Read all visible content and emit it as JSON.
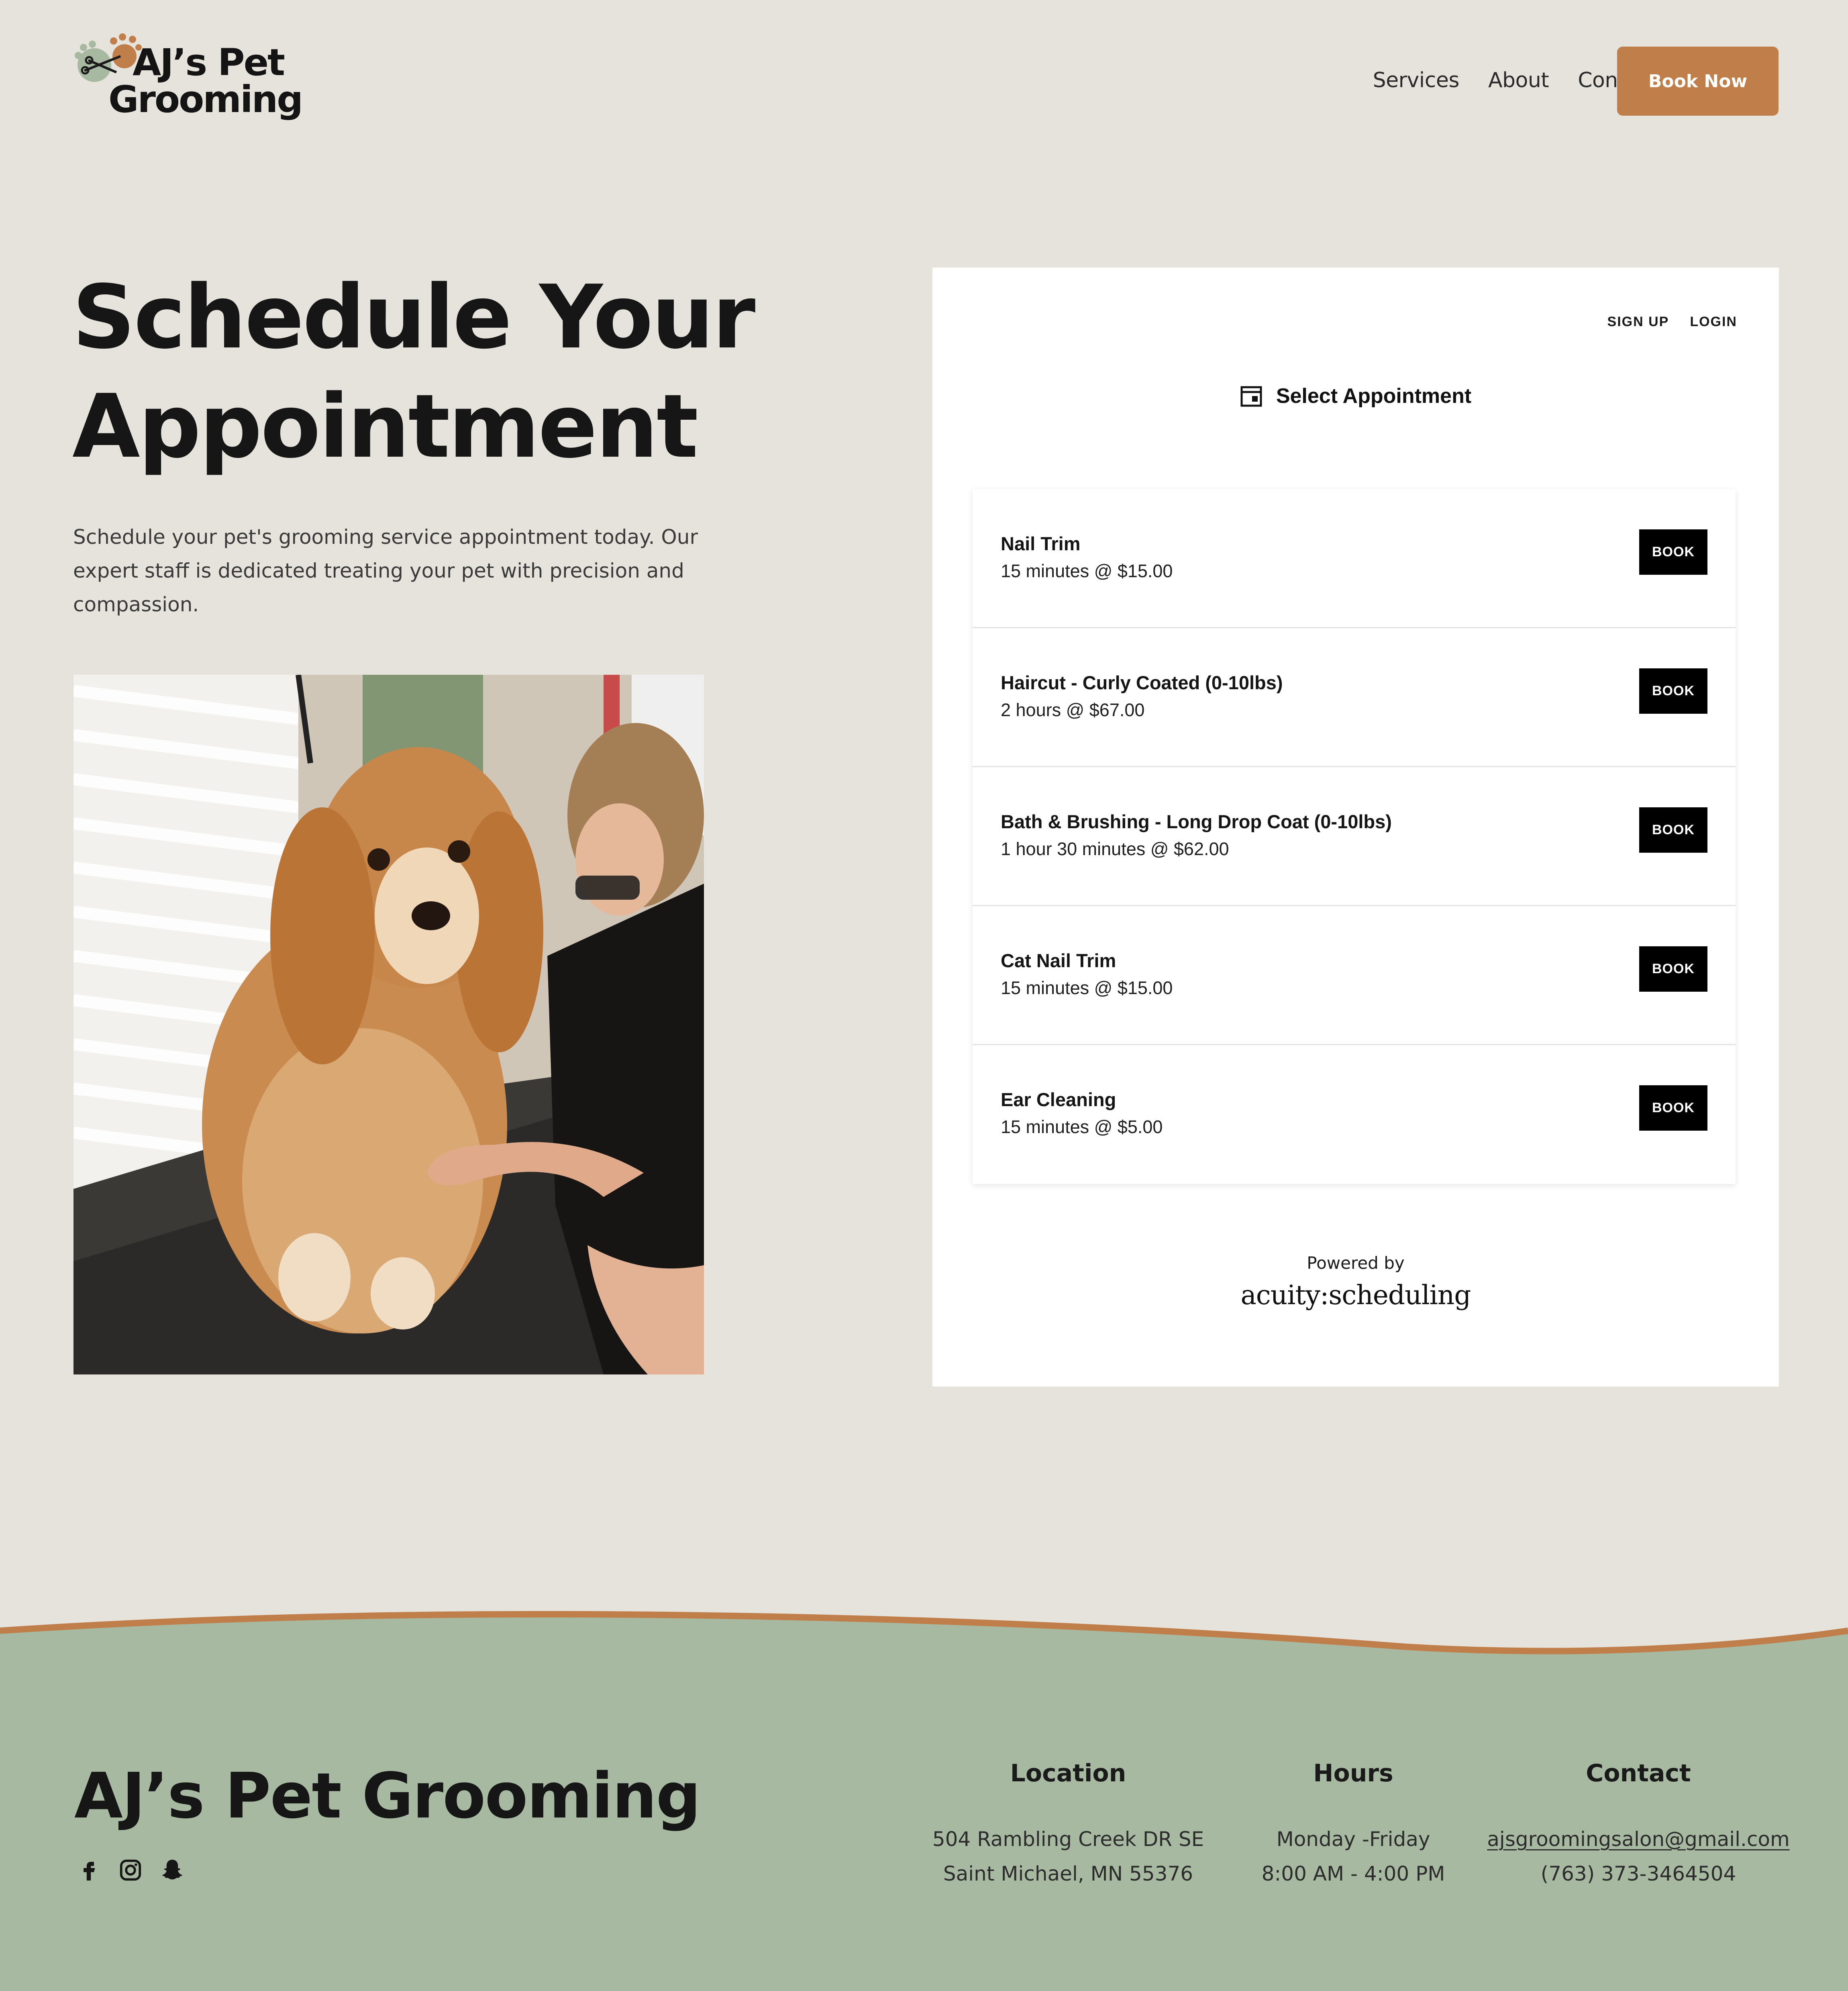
{
  "header": {
    "logo_line1": "AJ’s Pet",
    "logo_line2": "Grooming",
    "nav": [
      "Services",
      "About",
      "Contact"
    ],
    "cta": "Book Now"
  },
  "hero": {
    "title_line1": "Schedule Your",
    "title_line2": "Appointment",
    "description": "Schedule your pet's grooming service appointment today. Our expert staff is dedicated treating your pet with precision and compassion."
  },
  "scheduler": {
    "sign_up": "SIGN UP",
    "login": "LOGIN",
    "heading": "Select Appointment",
    "appointments": [
      {
        "name": "Nail Trim",
        "meta": "15 minutes @ $15.00",
        "button": "BOOK"
      },
      {
        "name": "Haircut - Curly Coated (0-10lbs)",
        "meta": "2 hours @ $67.00",
        "button": "BOOK"
      },
      {
        "name": "Bath & Brushing - Long Drop Coat (0-10lbs)",
        "meta": "1 hour 30 minutes @ $62.00",
        "button": "BOOK"
      },
      {
        "name": "Cat Nail Trim",
        "meta": "15 minutes @ $15.00",
        "button": "BOOK"
      },
      {
        "name": "Ear Cleaning",
        "meta": "15 minutes @ $5.00",
        "button": "BOOK"
      }
    ],
    "powered_by": "Powered by",
    "powered_brand": "acuity:scheduling"
  },
  "footer": {
    "brand": "AJ’s Pet Grooming",
    "socials": [
      "facebook-icon",
      "instagram-icon",
      "snapchat-icon"
    ],
    "location": {
      "heading": "Location",
      "line1": "504 Rambling Creek DR SE",
      "line2": "Saint Michael, MN 55376"
    },
    "hours": {
      "heading": "Hours",
      "line1": "Monday -Friday",
      "line2": "8:00 AM - 4:00 PM"
    },
    "contact": {
      "heading": "Contact",
      "email": "ajsgroomingsalon@gmail.com",
      "phone": "(763) 373-3464504"
    }
  },
  "colors": {
    "background": "#e6e3dd",
    "accent": "#c07f4a",
    "footer": "#a7b9a1",
    "button": "#000000"
  }
}
